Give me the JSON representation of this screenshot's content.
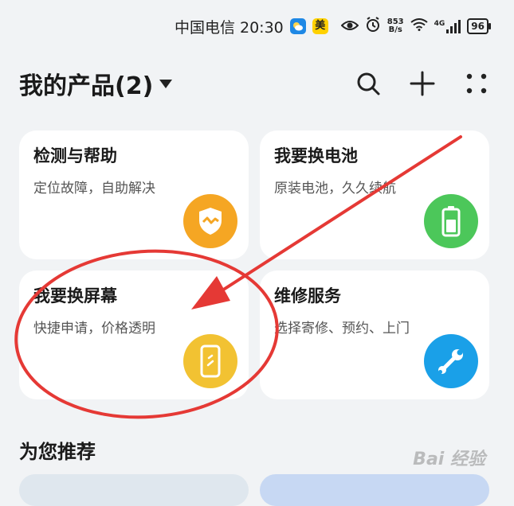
{
  "status_bar": {
    "carrier_time": "中国电信 20:30",
    "app_badge_1": "meituan-weather-icon",
    "app_badge_2": "美",
    "net_speed_top": "853",
    "net_speed_bottom": "B/s",
    "network": "4G",
    "battery": "96"
  },
  "header": {
    "title": "我的产品(2)",
    "icons": [
      "search-icon",
      "add-icon",
      "more-grid-icon"
    ]
  },
  "cards": [
    {
      "title": "检测与帮助",
      "subtitle": "定位故障，自助解决",
      "icon": "shield-check-icon",
      "icon_color": "#f5a623"
    },
    {
      "title": "我要换电池",
      "subtitle": "原装电池，久久续航",
      "icon": "battery-icon",
      "icon_color": "#4cc75a"
    },
    {
      "title": "我要换屏幕",
      "subtitle": "快捷申请，价格透明",
      "icon": "phone-screen-icon",
      "icon_color": "#f2c232"
    },
    {
      "title": "维修服务",
      "subtitle": "选择寄修、预约、上门",
      "icon": "wrench-icon",
      "icon_color": "#1aa0e8"
    }
  ],
  "recommend": {
    "title": "为您推荐"
  },
  "watermark": "Bai 经验",
  "colors": {
    "annotation": "#e53935",
    "background": "#f1f3f5"
  }
}
